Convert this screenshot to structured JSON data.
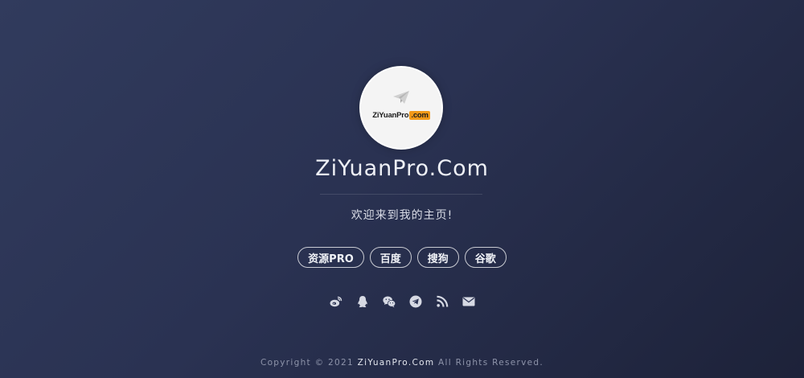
{
  "avatar": {
    "logo_main": "ZiYuanPro",
    "logo_suffix": ".com",
    "plane_icon": "paper-plane-icon"
  },
  "site": {
    "title": "ZiYuanPro.Com",
    "subtitle": "欢迎来到我的主页!"
  },
  "links": [
    {
      "label": "资源PRO"
    },
    {
      "label": "百度"
    },
    {
      "label": "搜狗"
    },
    {
      "label": "谷歌"
    }
  ],
  "socials": [
    {
      "icon": "weibo-icon"
    },
    {
      "icon": "qq-icon"
    },
    {
      "icon": "wechat-icon"
    },
    {
      "icon": "telegram-icon"
    },
    {
      "icon": "rss-icon"
    },
    {
      "icon": "email-icon"
    }
  ],
  "footer": {
    "prefix": "Copyright © 2021",
    "brand": "ZiYuanPro.Com",
    "suffix": "All Rights Reserved."
  },
  "colors": {
    "background_start": "#313b5d",
    "background_end": "#1d2239",
    "accent_orange": "#f39a1a",
    "text_light": "#eef0f6",
    "footer_text": "#8e94aa"
  }
}
